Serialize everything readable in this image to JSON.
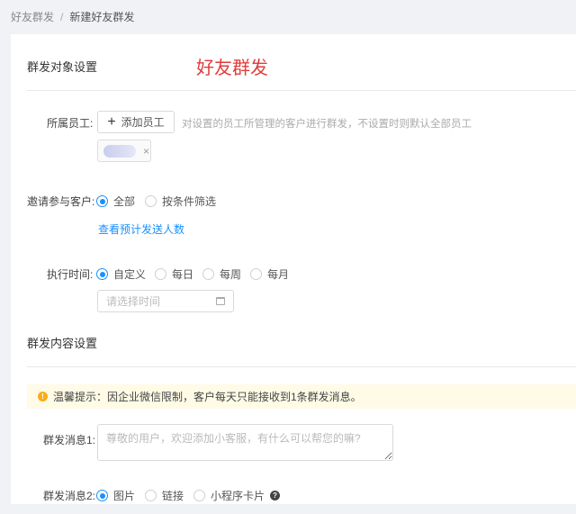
{
  "breadcrumb": {
    "items": [
      "好友群发",
      "新建好友群发"
    ],
    "separator": "/"
  },
  "section1": {
    "title": "群发对象设置",
    "overlay_title": "好友群发"
  },
  "staff": {
    "label": "所属员工:",
    "add_button": "添加员工",
    "hint": "对设置的员工所管理的客户进行群发，不设置时则默认全部员工",
    "tag_close": "×"
  },
  "invite": {
    "label": "邀请参与客户:",
    "options": [
      "全部",
      "按条件筛选"
    ],
    "selected": 0,
    "link": "查看预计发送人数"
  },
  "exec": {
    "label": "执行时间:",
    "options": [
      "自定义",
      "每日",
      "每周",
      "每月"
    ],
    "selected": 0,
    "date_placeholder": "请选择时间"
  },
  "section2": {
    "title": "群发内容设置"
  },
  "alert": {
    "text": "温馨提示：因企业微信限制，客户每天只能接收到1条群发消息。"
  },
  "msg1": {
    "label": "群发消息1:",
    "placeholder": "尊敬的用户，欢迎添加小客服，有什么可以帮您的嘛?"
  },
  "msg2": {
    "label": "群发消息2:",
    "options": [
      "图片",
      "链接",
      "小程序卡片"
    ],
    "selected": 0,
    "help": "?"
  },
  "colors": {
    "primary": "#1890ff",
    "accent_red": "#e23b3b",
    "alert_bg": "#fffbe6"
  }
}
